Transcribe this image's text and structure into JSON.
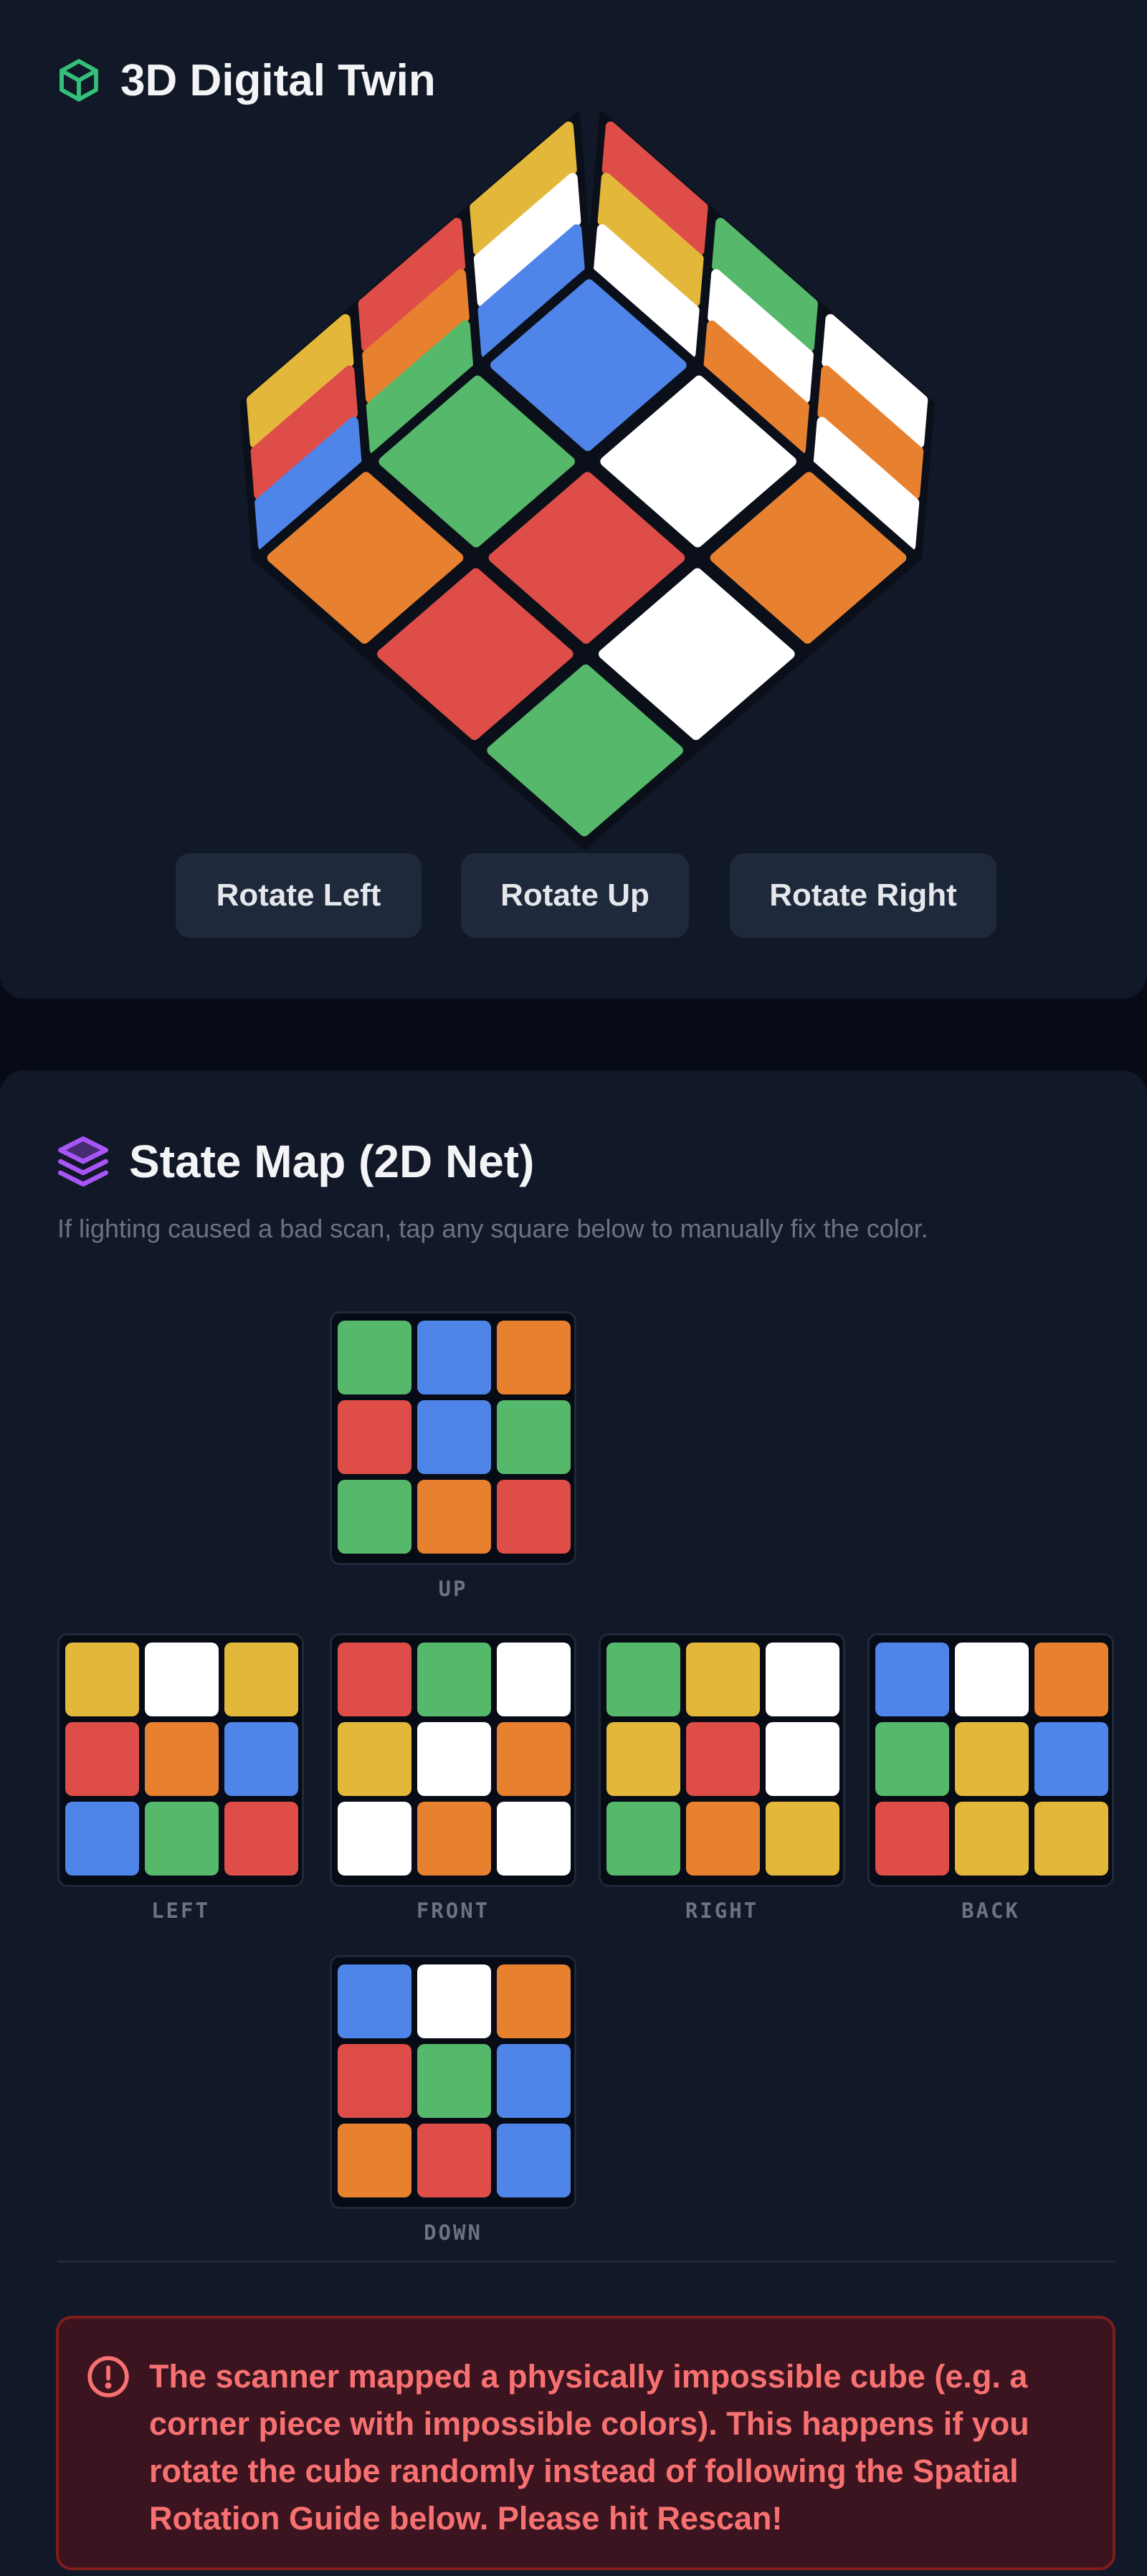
{
  "colors": {
    "W": "#ffffff",
    "Y": "#e3b73a",
    "R": "#de4d48",
    "O": "#e8812f",
    "G": "#55b86a",
    "B": "#4f85e9",
    "accent_green": "#34c07a",
    "accent_purple": "#a855f7",
    "error_red": "#f87171"
  },
  "twin": {
    "icon": "cube-icon",
    "title": "3D Digital Twin",
    "cube_view": {
      "top_face": [
        "B",
        "W",
        "O",
        "G",
        "R",
        "W",
        "O",
        "R",
        "G"
      ],
      "left_face": [
        "Y",
        "W",
        "B",
        "R",
        "O",
        "G",
        "Y",
        "R",
        "B"
      ],
      "right_face": [
        "R",
        "G",
        "W",
        "Y",
        "W",
        "O",
        "W",
        "O",
        "W"
      ]
    },
    "buttons": {
      "rotate_left": "Rotate Left",
      "rotate_up": "Rotate Up",
      "rotate_right": "Rotate Right"
    }
  },
  "state_map": {
    "icon": "layers-icon",
    "title": "State Map (2D Net)",
    "subtitle": "If lighting caused a bad scan, tap any square below to manually fix the color.",
    "faces": [
      {
        "key": "up",
        "label": "UP",
        "stickers": [
          "G",
          "B",
          "O",
          "R",
          "B",
          "G",
          "G",
          "O",
          "R"
        ]
      },
      {
        "key": "left",
        "label": "LEFT",
        "stickers": [
          "Y",
          "W",
          "Y",
          "R",
          "O",
          "B",
          "B",
          "G",
          "R"
        ]
      },
      {
        "key": "front",
        "label": "FRONT",
        "stickers": [
          "R",
          "G",
          "W",
          "Y",
          "W",
          "O",
          "W",
          "O",
          "W"
        ]
      },
      {
        "key": "right",
        "label": "RIGHT",
        "stickers": [
          "G",
          "Y",
          "W",
          "Y",
          "R",
          "W",
          "G",
          "O",
          "Y"
        ]
      },
      {
        "key": "back",
        "label": "BACK",
        "stickers": [
          "B",
          "W",
          "O",
          "G",
          "Y",
          "B",
          "R",
          "Y",
          "Y"
        ]
      },
      {
        "key": "down",
        "label": "DOWN",
        "stickers": [
          "B",
          "W",
          "O",
          "R",
          "G",
          "B",
          "O",
          "R",
          "B"
        ]
      }
    ]
  },
  "error": {
    "icon": "alert-circle-icon",
    "message": "The scanner mapped a physically impossible cube (e.g. a corner piece with impossible colors). This happens if you rotate the cube randomly instead of following the Spatial Rotation Guide below. Please hit Rescan!"
  }
}
